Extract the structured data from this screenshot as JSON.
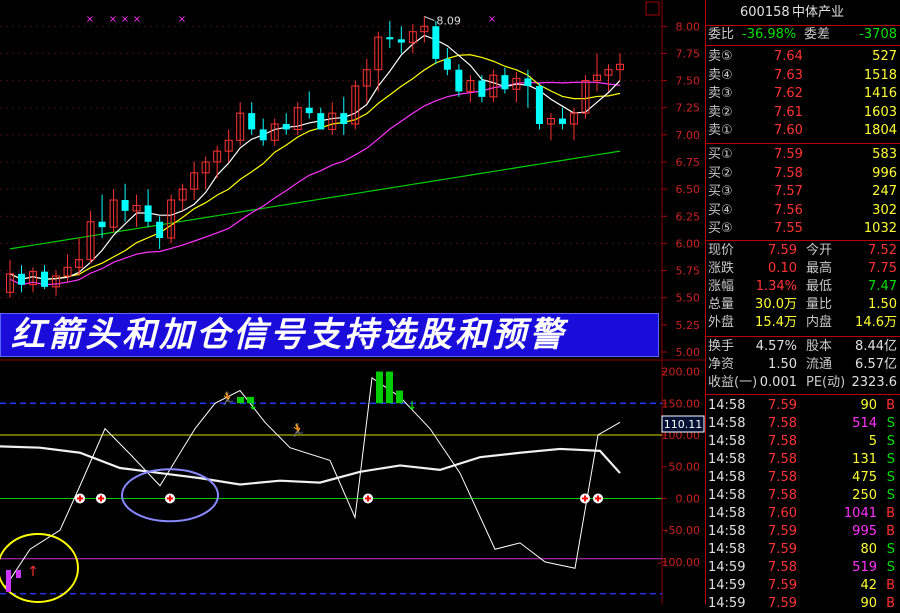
{
  "stock": {
    "code": "600158",
    "name": "中体产业"
  },
  "top_y_labels": [
    "8.00",
    "7.75",
    "7.50",
    "7.25",
    "7.00",
    "6.75",
    "6.50",
    "6.25",
    "6.00",
    "5.75",
    "5.50",
    "5.25",
    "5.00"
  ],
  "peak_label": "8.09",
  "banner_text": "红箭头和加仓信号支持选股和预警",
  "indicator_y_labels": [
    "200.00",
    "150.00",
    "100.00",
    "50.00",
    "0.00",
    "-50.00",
    "-100.00"
  ],
  "indicator_value": "110.11",
  "colors": {
    "up": "#ff3333",
    "down": "#00ffff",
    "ma5": "#ffffff",
    "ma10": "#ffff00",
    "ma20": "#ff33ff",
    "ma60": "#00cc00",
    "panel_border": "#bb0000",
    "banner_bg": "#1a0ddc"
  },
  "order_book": {
    "ratio_label": "委比",
    "ratio_value": "-36.98%",
    "diff_label": "委差",
    "diff_value": "-3708",
    "asks": [
      {
        "label": "卖⑤",
        "price": "7.64",
        "vol": "527"
      },
      {
        "label": "卖④",
        "price": "7.63",
        "vol": "1518"
      },
      {
        "label": "卖③",
        "price": "7.62",
        "vol": "1416"
      },
      {
        "label": "卖②",
        "price": "7.61",
        "vol": "1603"
      },
      {
        "label": "卖①",
        "price": "7.60",
        "vol": "1804"
      }
    ],
    "bids": [
      {
        "label": "买①",
        "price": "7.59",
        "vol": "583"
      },
      {
        "label": "买②",
        "price": "7.58",
        "vol": "996"
      },
      {
        "label": "买③",
        "price": "7.57",
        "vol": "247"
      },
      {
        "label": "买④",
        "price": "7.56",
        "vol": "302"
      },
      {
        "label": "买⑤",
        "price": "7.55",
        "vol": "1032"
      }
    ]
  },
  "quote": [
    {
      "l1": "现价",
      "v1": "7.59",
      "c1": "red",
      "l2": "今开",
      "v2": "7.52",
      "c2": "red"
    },
    {
      "l1": "涨跌",
      "v1": "0.10",
      "c1": "red",
      "l2": "最高",
      "v2": "7.75",
      "c2": "red"
    },
    {
      "l1": "涨幅",
      "v1": "1.34%",
      "c1": "red",
      "l2": "最低",
      "v2": "7.47",
      "c2": "green"
    },
    {
      "l1": "总量",
      "v1": "30.0万",
      "c1": "yel",
      "l2": "量比",
      "v2": "1.50",
      "c2": "yel"
    },
    {
      "l1": "外盘",
      "v1": "15.4万",
      "c1": "yel",
      "l2": "内盘",
      "v2": "14.6万",
      "c2": "yel"
    }
  ],
  "fundamentals": [
    {
      "l1": "换手",
      "v1": "4.57%",
      "l2": "股本",
      "v2": "8.44亿"
    },
    {
      "l1": "净资",
      "v1": "1.50",
      "l2": "流通",
      "v2": "6.57亿"
    },
    {
      "l1": "收益(一)",
      "v1": "0.001",
      "l2": "PE(动)",
      "v2": "2323.6"
    }
  ],
  "ticks": [
    {
      "time": "14:58",
      "price": "7.59",
      "pc": "red",
      "vol": "90",
      "vc": "yel",
      "side": "B",
      "sc": "red"
    },
    {
      "time": "14:58",
      "price": "7.58",
      "pc": "red",
      "vol": "514",
      "vc": "mag",
      "side": "S",
      "sc": "green"
    },
    {
      "time": "14:58",
      "price": "7.58",
      "pc": "red",
      "vol": "5",
      "vc": "yel",
      "side": "S",
      "sc": "green"
    },
    {
      "time": "14:58",
      "price": "7.58",
      "pc": "red",
      "vol": "131",
      "vc": "yel",
      "side": "S",
      "sc": "green"
    },
    {
      "time": "14:58",
      "price": "7.58",
      "pc": "red",
      "vol": "475",
      "vc": "yel",
      "side": "S",
      "sc": "green"
    },
    {
      "time": "14:58",
      "price": "7.58",
      "pc": "red",
      "vol": "250",
      "vc": "yel",
      "side": "S",
      "sc": "green"
    },
    {
      "time": "14:58",
      "price": "7.60",
      "pc": "red",
      "vol": "1041",
      "vc": "mag",
      "side": "B",
      "sc": "red"
    },
    {
      "time": "14:58",
      "price": "7.59",
      "pc": "red",
      "vol": "995",
      "vc": "mag",
      "side": "B",
      "sc": "red"
    },
    {
      "time": "14:58",
      "price": "7.59",
      "pc": "red",
      "vol": "80",
      "vc": "yel",
      "side": "S",
      "sc": "green"
    },
    {
      "time": "14:59",
      "price": "7.58",
      "pc": "red",
      "vol": "519",
      "vc": "mag",
      "side": "S",
      "sc": "green"
    },
    {
      "time": "14:59",
      "price": "7.59",
      "pc": "red",
      "vol": "42",
      "vc": "yel",
      "side": "B",
      "sc": "red"
    },
    {
      "time": "14:59",
      "price": "7.59",
      "pc": "red",
      "vol": "90",
      "vc": "yel",
      "side": "B",
      "sc": "red"
    }
  ],
  "chart_data": {
    "type": "candlestick",
    "y_range": [
      5.0,
      8.15
    ],
    "candles": [
      [
        5.55,
        5.85,
        5.5,
        5.72
      ],
      [
        5.72,
        5.8,
        5.55,
        5.62
      ],
      [
        5.62,
        5.78,
        5.55,
        5.74
      ],
      [
        5.74,
        5.8,
        5.58,
        5.6
      ],
      [
        5.6,
        5.75,
        5.52,
        5.7
      ],
      [
        5.7,
        5.9,
        5.65,
        5.78
      ],
      [
        5.78,
        6.05,
        5.7,
        5.85
      ],
      [
        5.85,
        6.3,
        5.82,
        6.2
      ],
      [
        6.2,
        6.45,
        6.05,
        6.15
      ],
      [
        6.15,
        6.5,
        6.1,
        6.4
      ],
      [
        6.4,
        6.55,
        6.2,
        6.3
      ],
      [
        6.3,
        6.45,
        6.15,
        6.35
      ],
      [
        6.35,
        6.5,
        6.15,
        6.2
      ],
      [
        6.2,
        6.25,
        5.95,
        6.05
      ],
      [
        6.05,
        6.45,
        6.0,
        6.4
      ],
      [
        6.4,
        6.55,
        6.3,
        6.5
      ],
      [
        6.5,
        6.75,
        6.4,
        6.65
      ],
      [
        6.65,
        6.8,
        6.5,
        6.75
      ],
      [
        6.75,
        6.9,
        6.6,
        6.85
      ],
      [
        6.85,
        7.05,
        6.75,
        6.95
      ],
      [
        6.95,
        7.3,
        6.9,
        7.2
      ],
      [
        7.2,
        7.3,
        7.0,
        7.05
      ],
      [
        7.05,
        7.15,
        6.9,
        6.95
      ],
      [
        6.95,
        7.15,
        6.9,
        7.1
      ],
      [
        7.1,
        7.2,
        7.0,
        7.05
      ],
      [
        7.05,
        7.3,
        7.0,
        7.25
      ],
      [
        7.25,
        7.4,
        7.15,
        7.2
      ],
      [
        7.2,
        7.25,
        7.05,
        7.05
      ],
      [
        7.05,
        7.3,
        7.0,
        7.2
      ],
      [
        7.2,
        7.35,
        7.0,
        7.1
      ],
      [
        7.1,
        7.5,
        7.05,
        7.45
      ],
      [
        7.45,
        7.7,
        7.3,
        7.6
      ],
      [
        7.6,
        7.95,
        7.4,
        7.9
      ],
      [
        7.9,
        8.05,
        7.8,
        7.88
      ],
      [
        7.88,
        8.0,
        7.75,
        7.85
      ],
      [
        7.85,
        8.02,
        7.75,
        7.95
      ],
      [
        7.95,
        8.09,
        7.85,
        8.0
      ],
      [
        8.0,
        8.05,
        7.65,
        7.7
      ],
      [
        7.7,
        7.8,
        7.55,
        7.6
      ],
      [
        7.6,
        7.65,
        7.35,
        7.4
      ],
      [
        7.4,
        7.55,
        7.3,
        7.5
      ],
      [
        7.5,
        7.55,
        7.3,
        7.35
      ],
      [
        7.35,
        7.6,
        7.3,
        7.55
      ],
      [
        7.55,
        7.62,
        7.38,
        7.42
      ],
      [
        7.42,
        7.58,
        7.3,
        7.52
      ],
      [
        7.52,
        7.6,
        7.25,
        7.45
      ],
      [
        7.45,
        7.48,
        7.05,
        7.1
      ],
      [
        7.1,
        7.2,
        6.95,
        7.15
      ],
      [
        7.15,
        7.25,
        7.05,
        7.1
      ],
      [
        7.1,
        7.25,
        6.95,
        7.2
      ],
      [
        7.2,
        7.55,
        7.15,
        7.5
      ],
      [
        7.5,
        7.75,
        7.4,
        7.55
      ],
      [
        7.55,
        7.65,
        7.4,
        7.6
      ],
      [
        7.6,
        7.75,
        7.5,
        7.65
      ]
    ]
  }
}
